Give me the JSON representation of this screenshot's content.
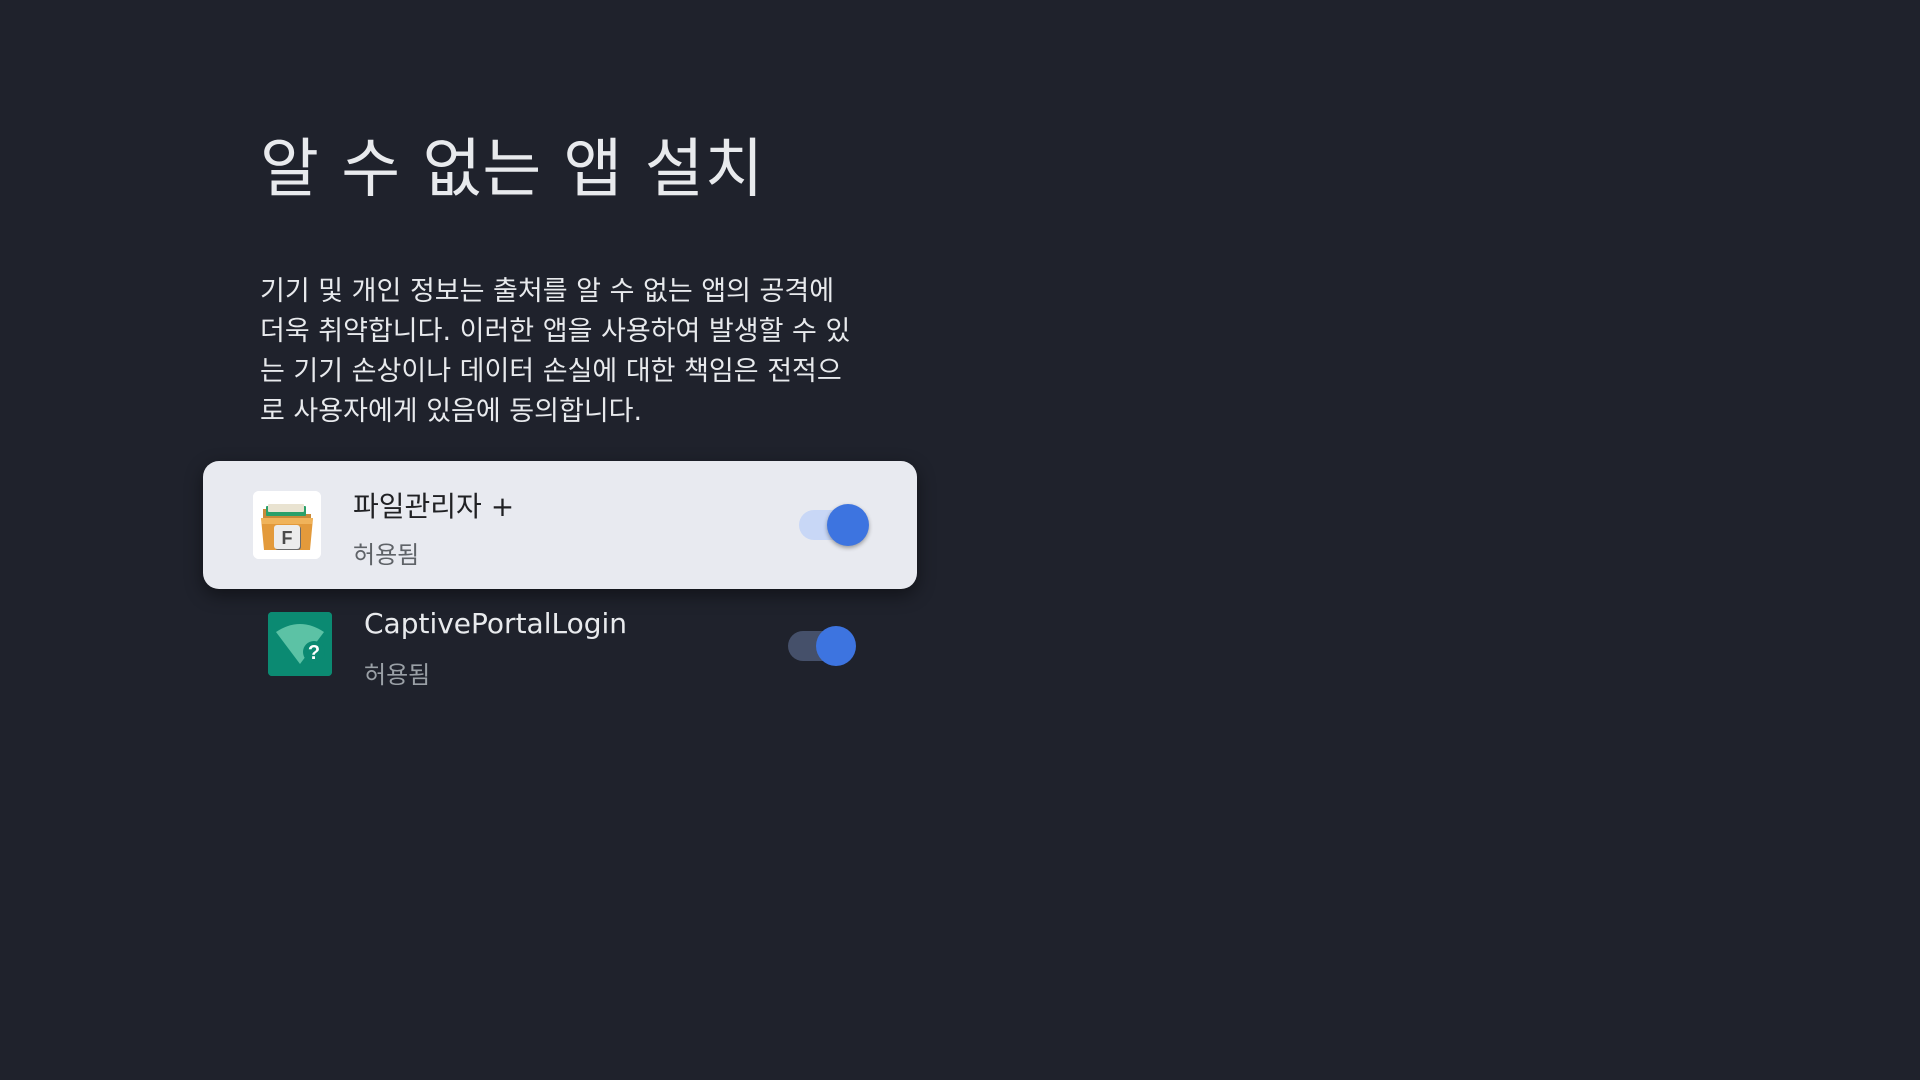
{
  "page": {
    "title": "알 수 없는 앱 설치",
    "description": "기기 및 개인 정보는 출처를 알 수 없는 앱의 공격에 더욱 취약합니다. 이러한 앱을 사용하여 발생할 수 있는 기기 손상이나 데이터 손실에 대한 책임은 전적으로 사용자에게 있음에 동의합니다."
  },
  "apps": [
    {
      "name": "파일관리자 +",
      "status": "허용됨",
      "icon": "file-manager-icon",
      "enabled": true,
      "focused": true
    },
    {
      "name": "CaptivePortalLogin",
      "status": "허용됨",
      "icon": "captive-portal-icon",
      "enabled": true,
      "focused": false
    }
  ],
  "colors": {
    "background": "#1f222c",
    "focused_card": "#e8eaf0",
    "toggle_accent": "#3d74e0"
  }
}
